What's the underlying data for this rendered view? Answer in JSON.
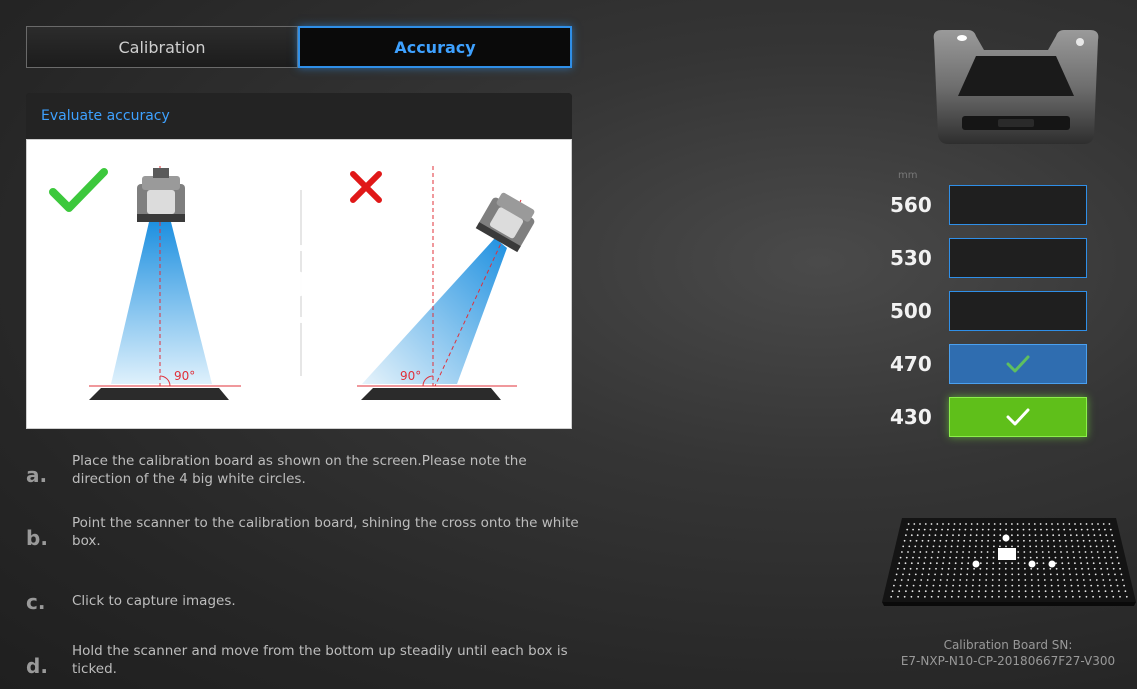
{
  "tabs": [
    {
      "label": "Calibration",
      "active": false
    },
    {
      "label": "Accuracy",
      "active": true
    }
  ],
  "panel": {
    "title": "Evaluate accuracy",
    "illustration": {
      "correct_angle": "90°",
      "incorrect_angle": "90°",
      "correct_icon": "check-icon",
      "incorrect_icon": "cross-icon",
      "play_icon": "play-icon"
    }
  },
  "steps": [
    {
      "letter": "a.",
      "text": "Place the calibration board as shown on the screen.Please note the direction of the 4 big white circles."
    },
    {
      "letter": "b.",
      "text": "Point the scanner to the calibration board, shining the cross onto the white box."
    },
    {
      "letter": "c.",
      "text": "Click to capture images."
    },
    {
      "letter": "d.",
      "text": "Hold the scanner and move from the bottom up steadily until each box is ticked."
    }
  ],
  "distances": {
    "unit": "mm",
    "rows": [
      {
        "value": "560",
        "state": "empty"
      },
      {
        "value": "530",
        "state": "empty"
      },
      {
        "value": "500",
        "state": "empty"
      },
      {
        "value": "470",
        "state": "done"
      },
      {
        "value": "430",
        "state": "current"
      }
    ]
  },
  "board": {
    "sn_title": "Calibration Board SN:",
    "sn_value": "E7-NXP-N10-CP-20180667F27-V300"
  },
  "colors": {
    "accent_blue": "#2f8fe8",
    "check_green": "#3cc83c",
    "cross_red": "#e01818",
    "done_box": "#2f6db0",
    "current_box": "#5fbf1a"
  }
}
